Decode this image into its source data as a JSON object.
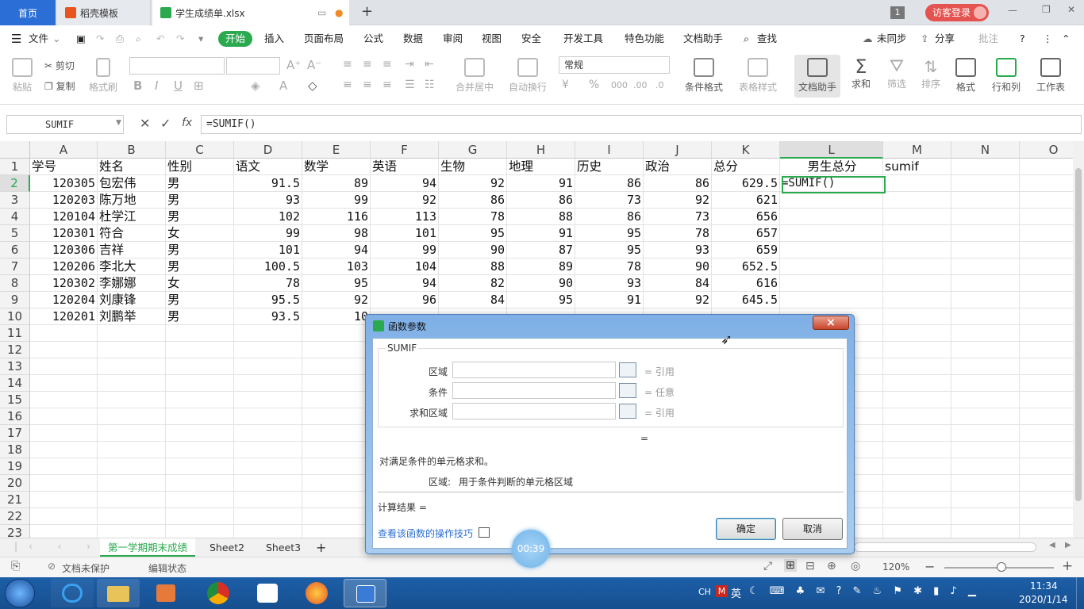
{
  "tabs": {
    "home": "首页",
    "template": "稻壳模板",
    "file": "学生成绩单.xlsx",
    "new_tab": "+",
    "badge": "1",
    "login": "访客登录"
  },
  "menu": {
    "file": "文件",
    "items": [
      "开始",
      "插入",
      "页面布局",
      "公式",
      "数据",
      "审阅",
      "视图",
      "安全",
      "开发工具",
      "特色功能",
      "文档助手"
    ],
    "search": "查找",
    "sync": "未同步",
    "share": "分享",
    "comment": "批注"
  },
  "ribbon": {
    "paste": "粘贴",
    "cut": "剪切",
    "copy": "复制",
    "format_painter": "格式刷",
    "merge": "合并居中",
    "wrap": "自动换行",
    "number_format": "常规",
    "cond_format": "条件格式",
    "table_style": "表格样式",
    "doc_helper": "文档助手",
    "sum": "求和",
    "filter": "筛选",
    "sort": "排序",
    "format": "格式",
    "row_col": "行和列",
    "worksheet": "工作表"
  },
  "formula": {
    "name_box": "SUMIF",
    "fx_label": "fx",
    "content": "=SUMIF()"
  },
  "columns": [
    "A",
    "B",
    "C",
    "D",
    "E",
    "F",
    "G",
    "H",
    "I",
    "J",
    "K",
    "L",
    "M",
    "N",
    "O"
  ],
  "rows": [
    "1",
    "2",
    "3",
    "4",
    "5",
    "6",
    "7",
    "8",
    "9",
    "10",
    "11",
    "12",
    "13",
    "14",
    "15",
    "16",
    "17",
    "18",
    "19",
    "20",
    "21",
    "22",
    "23"
  ],
  "headers": [
    "学号",
    "姓名",
    "性别",
    "语文",
    "数学",
    "英语",
    "生物",
    "地理",
    "历史",
    "政治",
    "总分",
    "男生总分",
    "sumif"
  ],
  "data": [
    [
      "120305",
      "包宏伟",
      "男",
      "91.5",
      "89",
      "94",
      "92",
      "91",
      "86",
      "86",
      "629.5",
      "=SUMIF()"
    ],
    [
      "120203",
      "陈万地",
      "男",
      "93",
      "99",
      "92",
      "86",
      "86",
      "73",
      "92",
      "621",
      ""
    ],
    [
      "120104",
      "杜学江",
      "男",
      "102",
      "116",
      "113",
      "78",
      "88",
      "86",
      "73",
      "656",
      ""
    ],
    [
      "120301",
      "符合",
      "女",
      "99",
      "98",
      "101",
      "95",
      "91",
      "95",
      "78",
      "657",
      ""
    ],
    [
      "120306",
      "吉祥",
      "男",
      "101",
      "94",
      "99",
      "90",
      "87",
      "95",
      "93",
      "659",
      ""
    ],
    [
      "120206",
      "李北大",
      "男",
      "100.5",
      "103",
      "104",
      "88",
      "89",
      "78",
      "90",
      "652.5",
      ""
    ],
    [
      "120302",
      "李娜娜",
      "女",
      "78",
      "95",
      "94",
      "82",
      "90",
      "93",
      "84",
      "616",
      ""
    ],
    [
      "120204",
      "刘康锋",
      "男",
      "95.5",
      "92",
      "96",
      "84",
      "95",
      "91",
      "92",
      "645.5",
      ""
    ],
    [
      "120201",
      "刘鹏举",
      "男",
      "93.5",
      "10",
      "",
      "",
      "",
      "",
      "",
      "",
      ""
    ]
  ],
  "sheets": [
    "第一学期期末成绩",
    "Sheet2",
    "Sheet3",
    "+"
  ],
  "status": {
    "protect": "文档未保护",
    "mode": "编辑状态",
    "zoom": "120%"
  },
  "dialog": {
    "title": "函数参数",
    "func": "SUMIF",
    "close": "×",
    "args": [
      {
        "label": "区域",
        "result": "= 引用"
      },
      {
        "label": "条件",
        "result": "= 任意"
      },
      {
        "label": "求和区域",
        "result": "= 引用"
      }
    ],
    "equals": "=",
    "desc": "对满足条件的单元格求和。",
    "arg_desc_label": "区域:",
    "arg_desc": "用于条件判断的单元格区域",
    "calc_result": "计算结果 =",
    "help_link": "查看该函数的操作技巧",
    "ok": "确定",
    "cancel": "取消"
  },
  "timer": "00:39",
  "clock": {
    "time": "11:34",
    "date": "2020/1/14",
    "lang": "CH",
    "ime": "英"
  },
  "colors": {
    "accent_green": "#2aa94f",
    "home_tab_blue": "#2b6fd6",
    "login_red": "#e4534f",
    "taskbar_blue": "#1d5fa8"
  }
}
